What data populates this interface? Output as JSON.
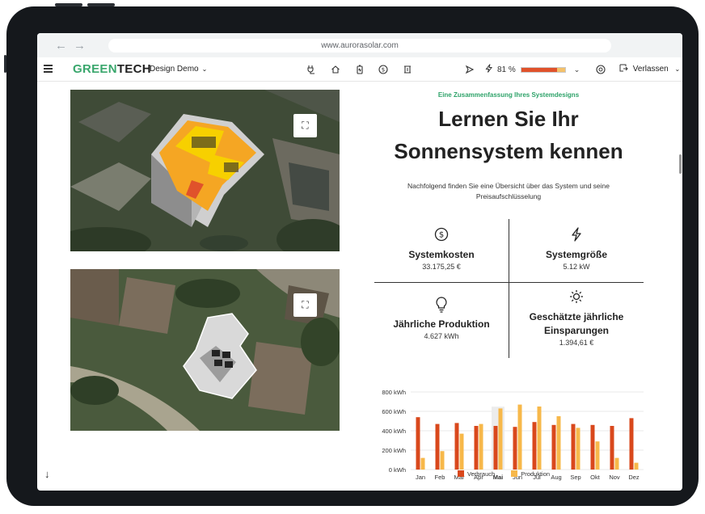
{
  "browser": {
    "url": "www.aurorasolar.com"
  },
  "appbar": {
    "logo_green": "GREEN",
    "logo_dark": "TECH",
    "project": "Design Demo",
    "energy_percent": "81 %",
    "energy_fraction": 0.81,
    "exit_label": "Verlassen"
  },
  "hero": {
    "kicker": "Eine Zusammenfassung Ihres Systemdesigns",
    "title": "Lernen Sie Ihr Sonnensystem kennen",
    "subtitle": "Nachfolgend finden Sie eine Übersicht über das System und seine Preisaufschlüsselung"
  },
  "stats": {
    "cost_title": "Systemkosten",
    "cost_value": "33.175,25 €",
    "size_title": "Systemgröße",
    "size_value": "5.12 kW",
    "production_title": "Jährliche Produktion",
    "production_value": "4.627 kWh",
    "savings_title": "Geschätzte jährliche Einsparungen",
    "savings_value": "1.394,61 €"
  },
  "chart_data": {
    "type": "bar",
    "categories": [
      "Jan",
      "Feb",
      "Mär",
      "Apr",
      "Mai",
      "Jun",
      "Jul",
      "Aug",
      "Sep",
      "Okt",
      "Nov",
      "Dez"
    ],
    "highlighted_category": "Mai",
    "series": [
      {
        "name": "Verbrauch",
        "color": "#d9481c",
        "values": [
          540,
          470,
          480,
          450,
          450,
          440,
          490,
          460,
          470,
          460,
          450,
          530
        ]
      },
      {
        "name": "Produktion",
        "color": "#f7b84a",
        "values": [
          120,
          190,
          370,
          470,
          630,
          670,
          650,
          550,
          430,
          290,
          120,
          70
        ]
      }
    ],
    "ylim": [
      0,
      800
    ],
    "yticks": [
      "0 kWh",
      "200 kWh",
      "400 kWh",
      "600 kWh",
      "800 kWh"
    ],
    "ytick_values": [
      0,
      200,
      400,
      600,
      800
    ],
    "grid": true,
    "legend": "bottom-center"
  },
  "colors": {
    "accent": "#2fa36a",
    "consumption": "#d9481c",
    "production": "#f7b84a"
  }
}
